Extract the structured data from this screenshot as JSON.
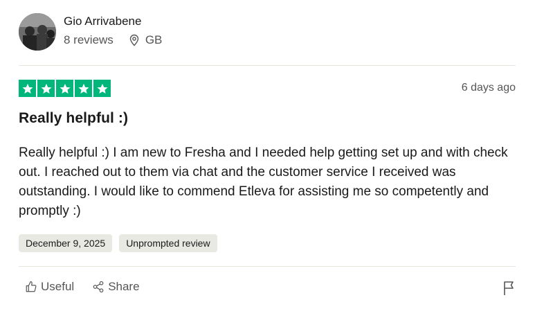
{
  "reviewer": {
    "name": "Gio Arrivabene",
    "reviews": "8 reviews",
    "country": "GB"
  },
  "review": {
    "rating": 5,
    "date_ago": "6 days ago",
    "title": "Really helpful :)",
    "body": "Really helpful :) I am new to Fresha and I needed help getting set up and with check out. I reached out to them via chat and the customer service I received was outstanding. I would like to commend Etleva for assisting me so competently and promptly :)",
    "experience_date": "December 9, 2025",
    "tag": "Unprompted review"
  },
  "actions": {
    "useful_label": "Useful",
    "share_label": "Share"
  },
  "colors": {
    "star_green": "#00b67a",
    "chip_bg": "#e9e9e4"
  }
}
